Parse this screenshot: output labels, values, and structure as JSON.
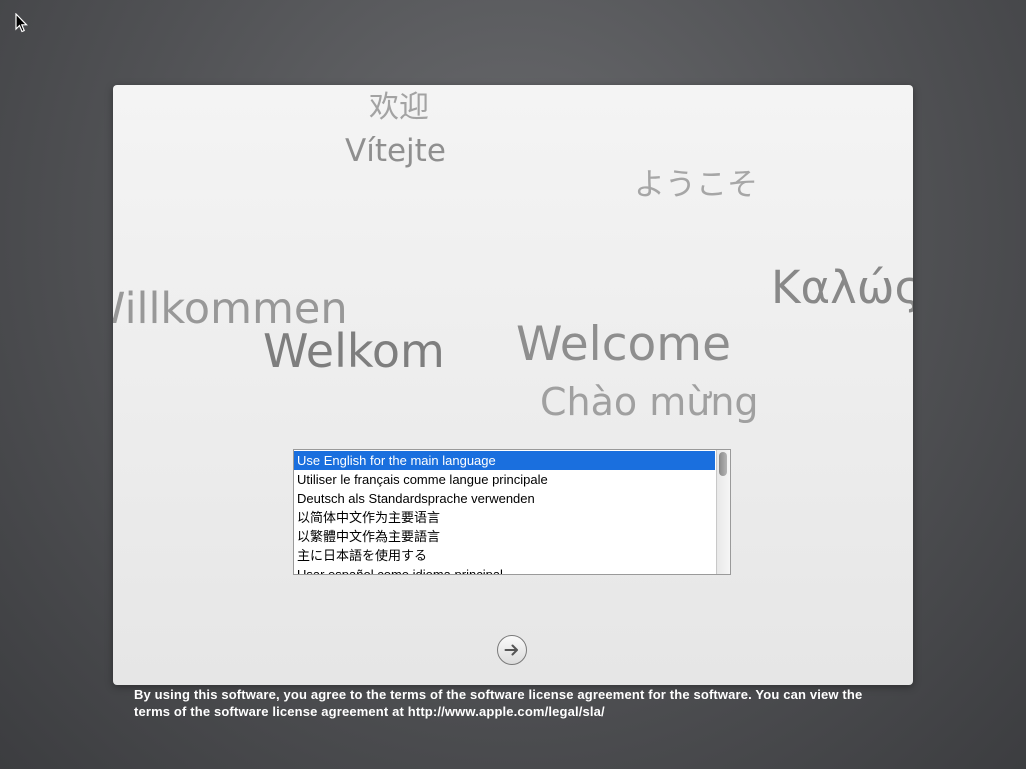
{
  "greetings": {
    "zh": "欢迎",
    "cs": "Vítejte",
    "ja": "ようこそ",
    "el": "Καλώς",
    "de": "Willkommen",
    "nl": "Welkom",
    "en": "Welcome",
    "vi": "Chào mừng"
  },
  "language_list": {
    "items": [
      "Use English for the main language",
      "Utiliser le français comme langue principale",
      "Deutsch als Standardsprache verwenden",
      "以简体中文作为主要语言",
      "以繁體中文作為主要語言",
      "主に日本語を使用する",
      "Usar español como idioma principal"
    ],
    "selected_index": 0
  },
  "icons": {
    "cursor": "arrow-cursor-icon",
    "next": "arrow-right-circle-icon"
  },
  "license": {
    "text": "By using this software, you agree to the terms of the software license agreement for the software. You can view the terms of the software license agreement at http://www.apple.com/legal/sla/"
  },
  "colors": {
    "selection": "#1a6fde",
    "background": "#505154",
    "panel": "#ececec"
  }
}
